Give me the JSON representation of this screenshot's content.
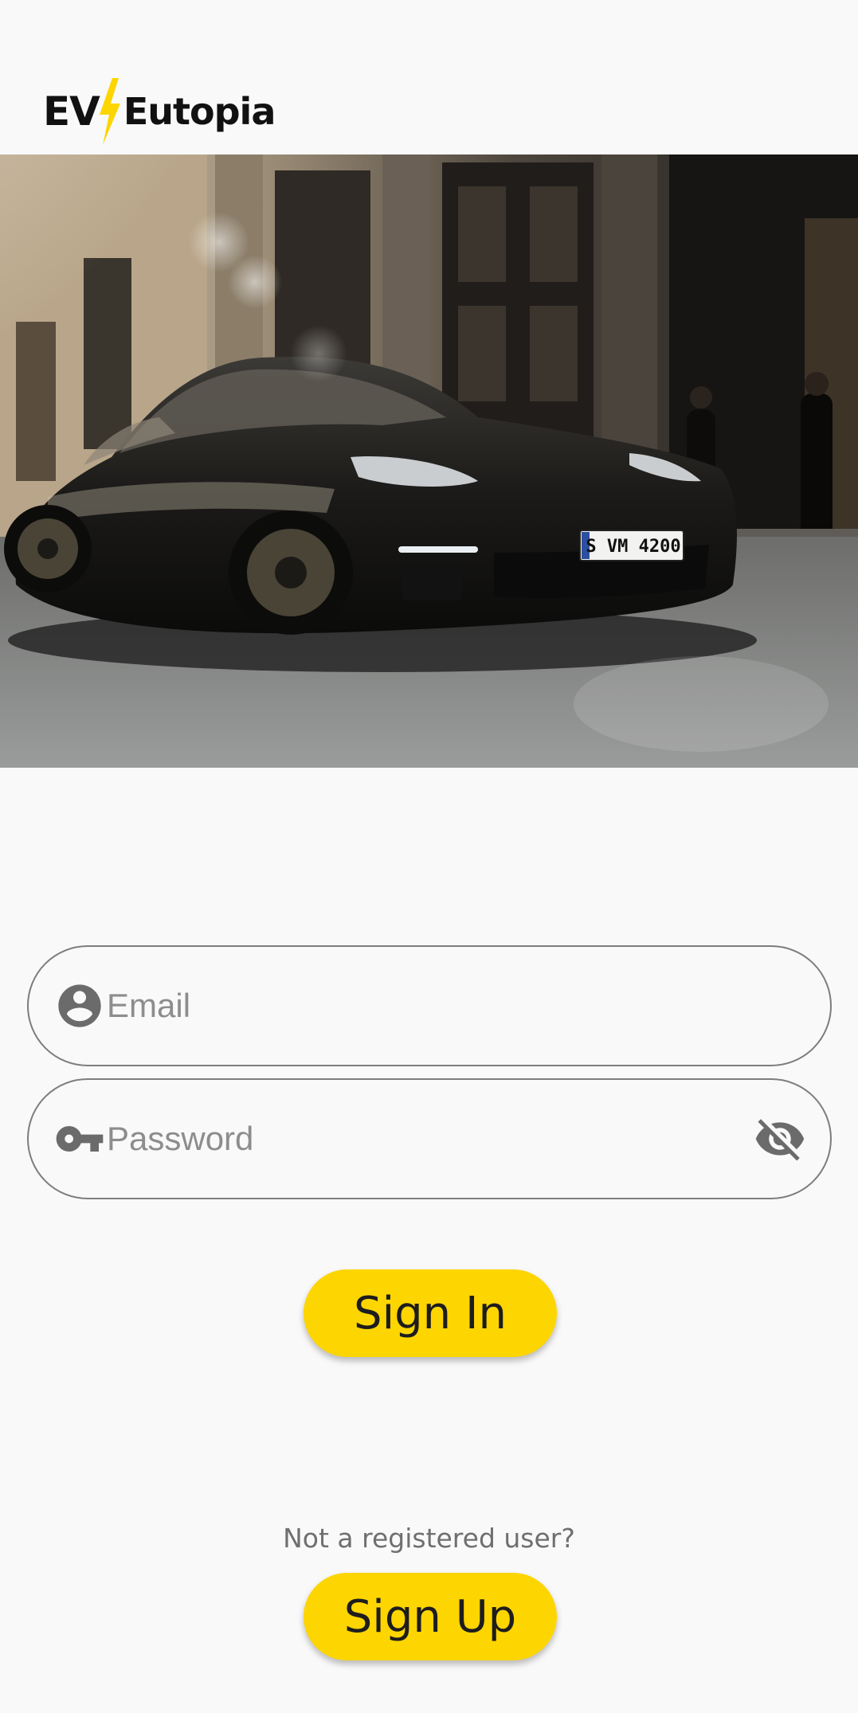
{
  "header": {
    "logo_ev": "EV",
    "logo_name": "Eutopia",
    "logo_bolt_color": "#fdd500"
  },
  "hero": {
    "license_plate": "S VM 4200"
  },
  "login_form": {
    "email": {
      "placeholder": "Email",
      "value": "",
      "icon": "account-circle-icon"
    },
    "password": {
      "placeholder": "Password",
      "value": "",
      "icon": "key-icon",
      "visibility_icon": "visibility-off-icon"
    },
    "sign_in_label": "Sign In"
  },
  "signup": {
    "prompt": "Not a registered user?",
    "sign_up_label": "Sign Up"
  },
  "colors": {
    "accent": "#fdd500",
    "background": "#f9f9f9",
    "field_border": "#7d7d7d",
    "icon_gray": "#6b6b6b"
  }
}
